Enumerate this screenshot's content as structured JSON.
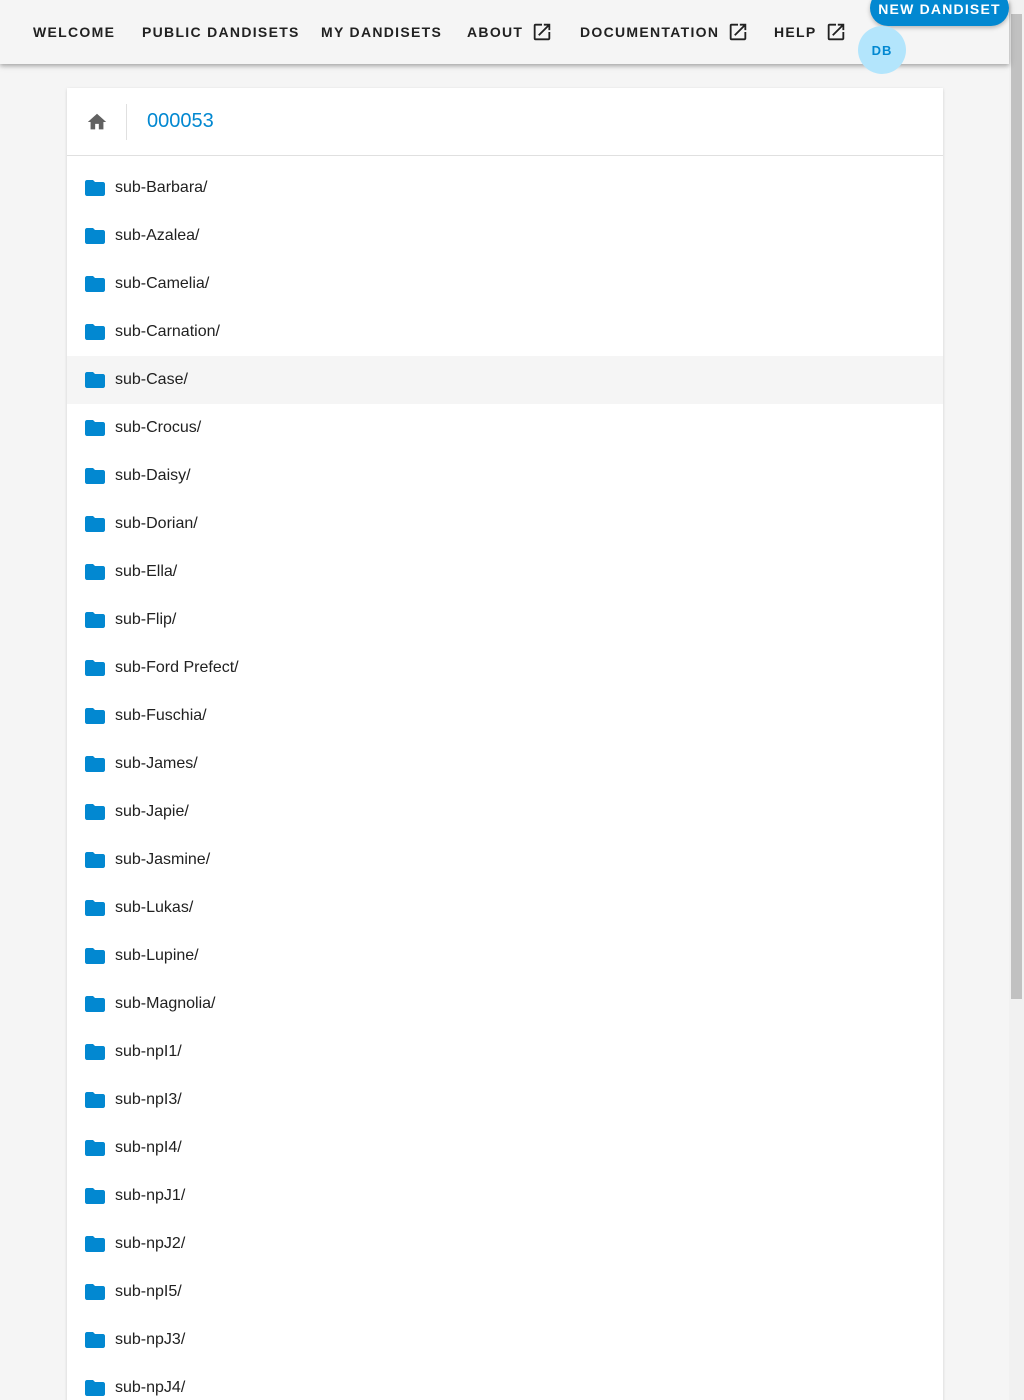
{
  "nav": {
    "items": [
      {
        "label": "WELCOME",
        "external": false
      },
      {
        "label": "PUBLIC DANDISETS",
        "external": false
      },
      {
        "label": "MY DANDISETS",
        "external": false
      },
      {
        "label": "ABOUT",
        "external": true
      },
      {
        "label": "DOCUMENTATION",
        "external": true
      },
      {
        "label": "HELP",
        "external": true
      }
    ],
    "new_dandiset_label": "NEW DANDISET",
    "avatar_initials": "DB"
  },
  "breadcrumb": {
    "home_icon": "home-icon",
    "current": "000053"
  },
  "folders": [
    "sub-Barbara/",
    "sub-Azalea/",
    "sub-Camelia/",
    "sub-Carnation/",
    "sub-Case/",
    "sub-Crocus/",
    "sub-Daisy/",
    "sub-Dorian/",
    "sub-Ella/",
    "sub-Flip/",
    "sub-Ford Prefect/",
    "sub-Fuschia/",
    "sub-James/",
    "sub-Japie/",
    "sub-Jasmine/",
    "sub-Lukas/",
    "sub-Lupine/",
    "sub-Magnolia/",
    "sub-npI1/",
    "sub-npI3/",
    "sub-npI4/",
    "sub-npJ1/",
    "sub-npJ2/",
    "sub-npI5/",
    "sub-npJ3/",
    "sub-npJ4/"
  ],
  "hovered_folder": "sub-Case/",
  "colors": {
    "accent": "#0288d1",
    "avatar_bg": "#b3e5fc",
    "folder_icon": "#0288d1",
    "row_hover": "#f5f5f5"
  }
}
